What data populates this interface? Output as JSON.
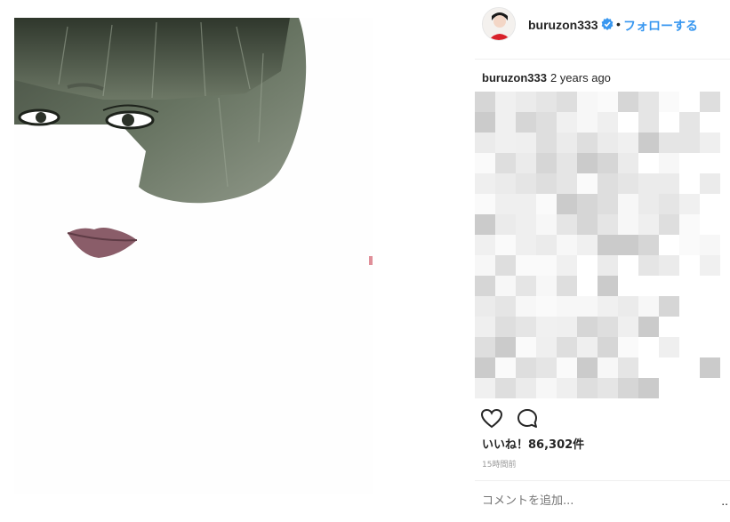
{
  "post": {
    "username": "buruzon333",
    "follow_label": "フォローする",
    "separator": "•",
    "caption_username": "buruzon333",
    "caption_time": "2 years ago",
    "likes_text": "いいね！86,302件",
    "relative_time": "15時間前",
    "comment_placeholder": "コメントを追加...",
    "more_options": "..",
    "icons": [
      "verified-badge-icon",
      "heart-icon",
      "comment-icon",
      "more-options-icon"
    ],
    "colors": {
      "accent": "#3897f0",
      "text": "#262626",
      "muted": "#999999",
      "avatar_dress": "#d8212a"
    }
  }
}
